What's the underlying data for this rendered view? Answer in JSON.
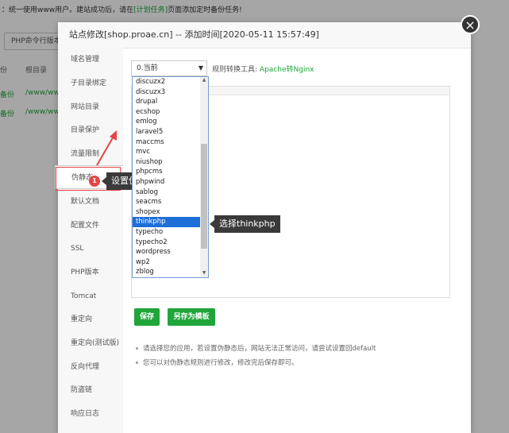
{
  "background": {
    "notice_prefix": "：统一使用www用户。建站成功后，请在",
    "notice_link": "[计划任务]",
    "notice_suffix": "页面添加定时备份任务!",
    "php_cli_button": "PHP命令行版本",
    "col_backup": "份",
    "col_root": "根目录",
    "rows": [
      {
        "backup": "备份",
        "path": "/www/www"
      },
      {
        "backup": "备份",
        "path": "/www/www"
      }
    ]
  },
  "modal": {
    "title": "站点修改[shop.proae.cn] -- 添加时间[2020-05-11 15:57:49]",
    "close_icon": "×"
  },
  "sidebar": {
    "items": [
      {
        "label": "域名管理"
      },
      {
        "label": "子目录绑定"
      },
      {
        "label": "网站目录"
      },
      {
        "label": "目录保护"
      },
      {
        "label": "流量限制"
      },
      {
        "label": "伪静态"
      },
      {
        "label": "默认文档"
      },
      {
        "label": "配置文件"
      },
      {
        "label": "SSL"
      },
      {
        "label": "PHP版本"
      },
      {
        "label": "Tomcat"
      },
      {
        "label": "重定向"
      },
      {
        "label": "重定向(测试版)"
      },
      {
        "label": "反向代理"
      },
      {
        "label": "防盗链"
      },
      {
        "label": "响应日志"
      }
    ],
    "active_index": 5
  },
  "rewrite": {
    "select_value": "0.当前",
    "convert_label": "规则转换工具:",
    "convert_link": "Apache转Nginx",
    "options": [
      "discuzx2",
      "discuzx3",
      "drupal",
      "ecshop",
      "emlog",
      "laravel5",
      "maccms",
      "mvc",
      "niushop",
      "phpcms",
      "phpwind",
      "sablog",
      "seacms",
      "shopex",
      "thinkphp",
      "typecho",
      "typecho2",
      "wordpress",
      "wp2",
      "zblog"
    ],
    "selected_option": "thinkphp",
    "save_button": "保存",
    "save_template_button": "另存为模板",
    "tips": [
      "请选择您的应用，若设置伪静态后，网站无法正常访问，请尝试设置回default",
      "您可以对伪静态规则进行修改，修改完后保存即可。"
    ]
  },
  "annotations": {
    "step1_badge": "1",
    "step1_text": "设置伪静态",
    "step2_badge": "2",
    "step2_text": "选择thinkphp"
  },
  "colors": {
    "accent_green": "#20a53a",
    "annotation_red": "#e54545",
    "selection_blue": "#1e6fd9"
  }
}
